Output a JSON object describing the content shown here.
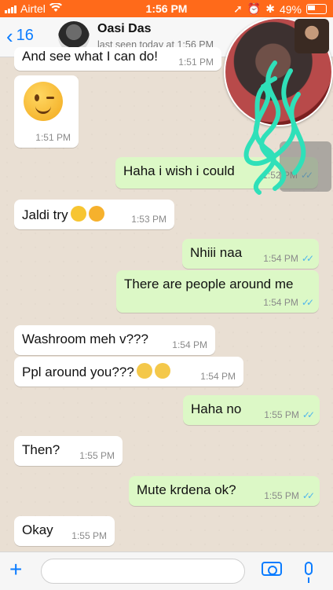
{
  "status_bar": {
    "carrier": "Airtel",
    "time": "1:56 PM",
    "battery": "49%"
  },
  "header": {
    "back_count": "16",
    "contact_name": "Oasi Das",
    "last_seen": "last seen today at 1:56 PM"
  },
  "messages": [
    {
      "dir": "in",
      "text": "And see what I can do!",
      "time": "1:51 PM"
    },
    {
      "dir": "in",
      "text": "",
      "emoji": "wink",
      "time": "1:51 PM"
    },
    {
      "dir": "out",
      "text": "Haha i wish i could",
      "time": "1:52 PM"
    },
    {
      "dir": "in",
      "text": "Jaldi try",
      "time": "1:53 PM"
    },
    {
      "dir": "out",
      "text": "Nhiii naa",
      "time": "1:54 PM"
    },
    {
      "dir": "out",
      "text": "There are people around me",
      "time": "1:54 PM"
    },
    {
      "dir": "in",
      "text": "Washroom meh v???",
      "time": "1:54 PM"
    },
    {
      "dir": "in",
      "text": "Ppl around you???",
      "time": "1:54 PM"
    },
    {
      "dir": "out",
      "text": "Haha no",
      "time": "1:55 PM"
    },
    {
      "dir": "in",
      "text": "Then?",
      "time": "1:55 PM"
    },
    {
      "dir": "out",
      "text": "Mute krdena ok?",
      "time": "1:55 PM"
    },
    {
      "dir": "in",
      "text": "Okay",
      "time": "1:55 PM"
    }
  ],
  "colors": {
    "status_bar": "#ff6a1a",
    "accent": "#0b7cff",
    "outgoing_bubble": "#dcf8c6",
    "incoming_bubble": "#ffffff",
    "read_ticks": "#4fb6ec"
  },
  "icons": [
    "signal-icon",
    "wifi-icon",
    "alarm-icon",
    "bluetooth-icon",
    "battery-icon",
    "back-chevron-icon",
    "plus-icon",
    "camera-icon",
    "microphone-icon"
  ]
}
